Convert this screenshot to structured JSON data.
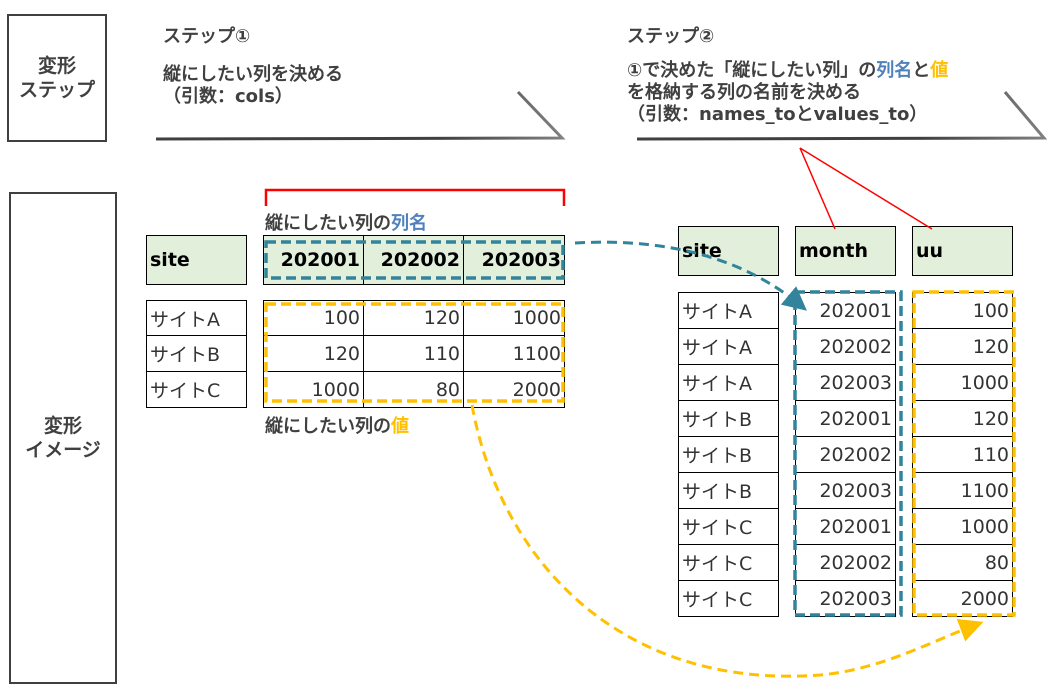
{
  "row_labels": {
    "step_label": [
      "変形",
      "ステップ"
    ],
    "image_label": [
      "変形",
      "イメージ"
    ]
  },
  "step1": {
    "title": "ステップ①",
    "desc_line1": "縦にしたい列を決める",
    "desc_line2": "（引数：cols）"
  },
  "step2": {
    "title": "ステップ②",
    "desc_line1_a": "①で決めた「縦にしたい列」の",
    "desc_line1_b": "列名",
    "desc_line1_c": "と",
    "desc_line1_d": "値",
    "desc_line2": "を格納する列の名前を決める",
    "desc_line3": "（引数：names_toとvalues_to）"
  },
  "colors": {
    "names_highlight": "#4f81bd",
    "values_highlight": "#ffc000",
    "names_dash": "#31849b",
    "bracket": "#ff0000",
    "header_fill": "#e2efda"
  },
  "wide_table": {
    "caption_names_a": "縦にしたい列の",
    "caption_names_b": "列名",
    "caption_values_a": "縦にしたい列の",
    "caption_values_b": "値",
    "site_header": "site",
    "month_headers": [
      "202001",
      "202002",
      "202003"
    ],
    "rows": [
      {
        "site": "サイトA",
        "values": [
          "100",
          "120",
          "1000"
        ]
      },
      {
        "site": "サイトB",
        "values": [
          "120",
          "110",
          "1100"
        ]
      },
      {
        "site": "サイトC",
        "values": [
          "1000",
          "80",
          "2000"
        ]
      }
    ]
  },
  "long_table": {
    "headers": [
      "site",
      "month",
      "uu"
    ],
    "rows": [
      {
        "site": "サイトA",
        "month": "202001",
        "uu": "100"
      },
      {
        "site": "サイトA",
        "month": "202002",
        "uu": "120"
      },
      {
        "site": "サイトA",
        "month": "202003",
        "uu": "1000"
      },
      {
        "site": "サイトB",
        "month": "202001",
        "uu": "120"
      },
      {
        "site": "サイトB",
        "month": "202002",
        "uu": "110"
      },
      {
        "site": "サイトB",
        "month": "202003",
        "uu": "1100"
      },
      {
        "site": "サイトC",
        "month": "202001",
        "uu": "1000"
      },
      {
        "site": "サイトC",
        "month": "202002",
        "uu": "80"
      },
      {
        "site": "サイトC",
        "month": "202003",
        "uu": "2000"
      }
    ]
  }
}
